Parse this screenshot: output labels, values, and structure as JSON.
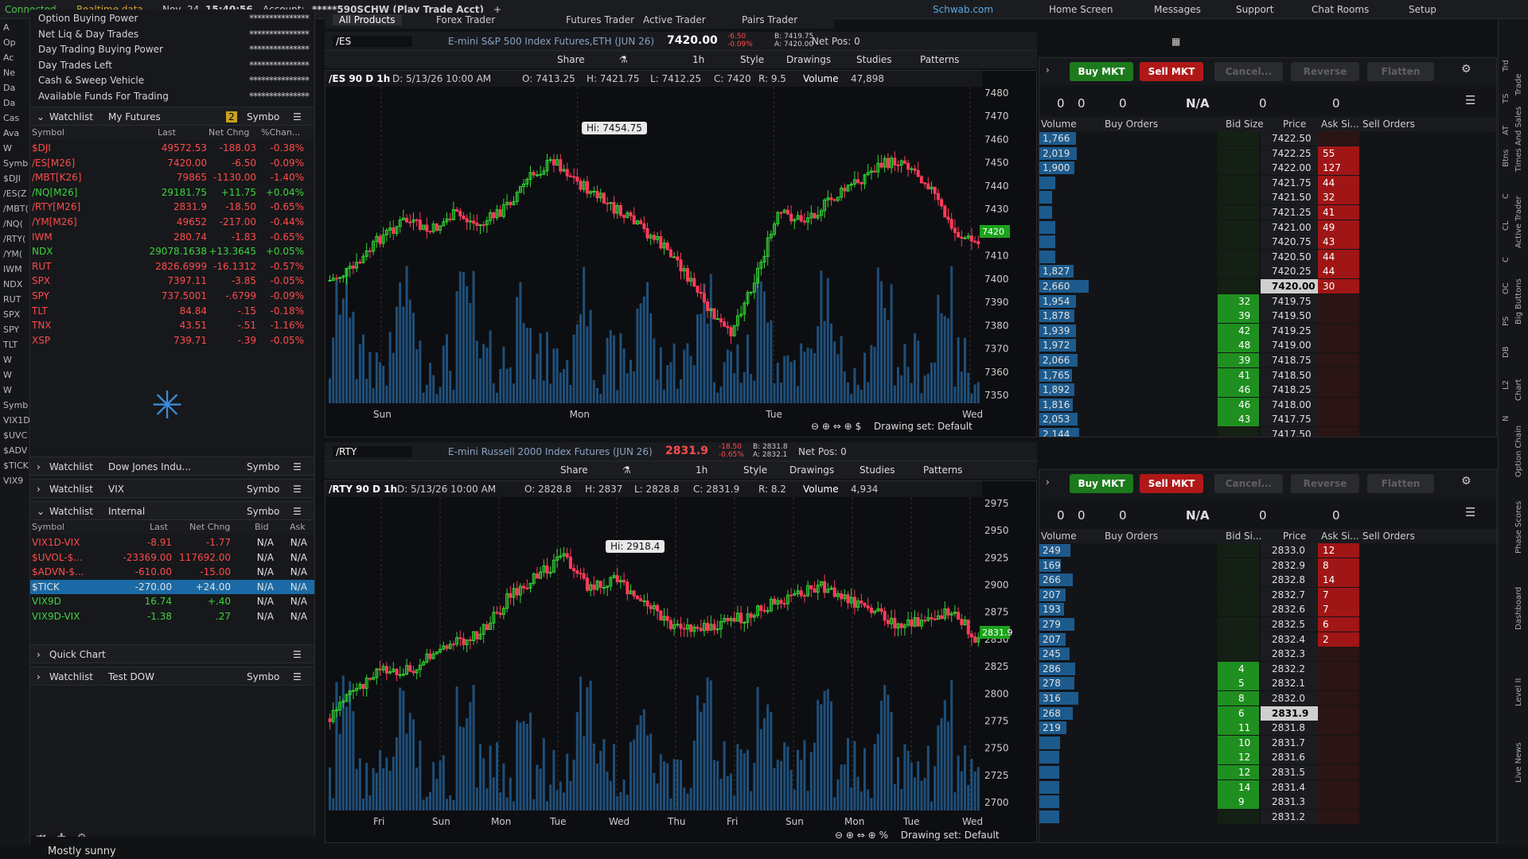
{
  "topbar": {
    "connected": "Connected",
    "realtime": "Realtime data",
    "date": "Nov, 24",
    "time": "15:40:56",
    "account_label": "Account:",
    "account": "*****590SCHW (Play Trade Acct)",
    "tabs": [
      "All Products",
      "Forex Trader",
      "Futures Trader",
      "Active Trader",
      "Pairs Trader"
    ],
    "links": [
      "Schwab.com",
      "Home Screen",
      "Messages",
      "Support",
      "Chat Rooms",
      "Setup"
    ]
  },
  "left_strip": {
    "items": [
      "A",
      "Op",
      "Ac",
      "Ne",
      "Da",
      "Da",
      "Cas",
      "Ava",
      "W",
      "Symb",
      "$DJI",
      "/ES(Z",
      "/MBT(",
      "/NQ(",
      "/RTY(",
      "/YM(",
      "IWM",
      "NDX",
      "RUT",
      "SPX",
      "SPY",
      "TLT",
      "W",
      "W",
      "W",
      "Symb",
      "VIX1D",
      "$UVC",
      "$ADV",
      "$TICK",
      "VIX9"
    ]
  },
  "balances": [
    {
      "label": "Option Buying Power",
      "value": "***************"
    },
    {
      "label": "Net Liq & Day Trades",
      "value": "***************"
    },
    {
      "label": "Day Trading Buying Power",
      "value": "***************"
    },
    {
      "label": "Day Trades Left",
      "value": "***************"
    },
    {
      "label": "Cash & Sweep Vehicle",
      "value": "***************"
    },
    {
      "label": "Available Funds For Trading",
      "value": "***************"
    }
  ],
  "watchlist1": {
    "title": "Watchlist",
    "name": "My Futures",
    "badge": "2",
    "symbol_field": "Symbo",
    "columns": [
      "Symbol",
      "Last",
      "Net Chng",
      "%Chan..."
    ],
    "rows": [
      {
        "sym": "$DJI",
        "last": "49572.53",
        "chg": "-188.03",
        "pct": "-0.38%",
        "dir": "dn"
      },
      {
        "sym": "/ES[M26]",
        "last": "7420.00",
        "chg": "-6.50",
        "pct": "-0.09%",
        "dir": "dn"
      },
      {
        "sym": "/MBT[K26]",
        "last": "79865",
        "chg": "-1130.00",
        "pct": "-1.40%",
        "dir": "dn"
      },
      {
        "sym": "/NQ[M26]",
        "last": "29181.75",
        "chg": "+11.75",
        "pct": "+0.04%",
        "dir": "up"
      },
      {
        "sym": "/RTY[M26]",
        "last": "2831.9",
        "chg": "-18.50",
        "pct": "-0.65%",
        "dir": "dn"
      },
      {
        "sym": "/YM[M26]",
        "last": "49652",
        "chg": "-217.00",
        "pct": "-0.44%",
        "dir": "dn"
      },
      {
        "sym": "IWM",
        "last": "280.74",
        "chg": "-1.83",
        "pct": "-0.65%",
        "dir": "dn"
      },
      {
        "sym": "NDX",
        "last": "29078.1638",
        "chg": "+13.3645",
        "pct": "+0.05%",
        "dir": "up"
      },
      {
        "sym": "RUT",
        "last": "2826.6999",
        "chg": "-16.1312",
        "pct": "-0.57%",
        "dir": "dn"
      },
      {
        "sym": "SPX",
        "last": "7397.11",
        "chg": "-3.85",
        "pct": "-0.05%",
        "dir": "dn"
      },
      {
        "sym": "SPY",
        "last": "737.5001",
        "chg": "-.6799",
        "pct": "-0.09%",
        "dir": "dn"
      },
      {
        "sym": "TLT",
        "last": "84.84",
        "chg": "-.15",
        "pct": "-0.18%",
        "dir": "dn"
      },
      {
        "sym": "TNX",
        "last": "43.51",
        "chg": "-.51",
        "pct": "-1.16%",
        "dir": "dn"
      },
      {
        "sym": "XSP",
        "last": "739.71",
        "chg": "-.39",
        "pct": "-0.05%",
        "dir": "dn"
      }
    ]
  },
  "watchlist_dow": {
    "title": "Watchlist",
    "name": "Dow Jones Indu...",
    "symbol_field": "Symbo"
  },
  "watchlist_vix": {
    "title": "Watchlist",
    "name": "VIX",
    "symbol_field": "Symbo"
  },
  "watchlist_internal": {
    "title": "Watchlist",
    "name": "Internal",
    "symbol_field": "Symbo",
    "columns": [
      "Symbol",
      "Last",
      "Net Chng",
      "Bid",
      "Ask"
    ],
    "rows": [
      {
        "sym": "VIX1D-VIX",
        "last": "-8.91",
        "chg": "-1.77",
        "bid": "N/A",
        "ask": "N/A",
        "dir": "dn"
      },
      {
        "sym": "$UVOL-$...",
        "last": "-23369.00",
        "chg": "117692.00",
        "bid": "N/A",
        "ask": "N/A",
        "dir": "dn"
      },
      {
        "sym": "$ADVN-$...",
        "last": "-610.00",
        "chg": "-15.00",
        "bid": "N/A",
        "ask": "N/A",
        "dir": "dn"
      },
      {
        "sym": "$TICK",
        "last": "-270.00",
        "chg": "+24.00",
        "bid": "N/A",
        "ask": "N/A",
        "dir": "sel"
      },
      {
        "sym": "VIX9D",
        "last": "16.74",
        "chg": "+.40",
        "bid": "N/A",
        "ask": "N/A",
        "dir": "up"
      },
      {
        "sym": "VIX9D-VIX",
        "last": "-1.38",
        "chg": ".27",
        "bid": "N/A",
        "ask": "N/A",
        "dir": "up"
      }
    ]
  },
  "quick_chart": {
    "label": "Quick Chart"
  },
  "watchlist_testdow": {
    "title": "Watchlist",
    "name": "Test DOW",
    "symbol_field": "Symbo"
  },
  "weather": "Mostly sunny",
  "chart1": {
    "symbol": "/ES",
    "desc": "E-mini S&P 500 Index Futures,ETH (JUN 26)",
    "price": "7420.00",
    "chg": "-6.50",
    "pct": "-0.09%",
    "bid": "B: 7419.75",
    "ask": "A: 7420.00",
    "netpos": "Net Pos: 0",
    "toolbar": [
      "Share",
      "1h",
      "Style",
      "Drawings",
      "Studies",
      "Patterns"
    ],
    "title": "/ES 90 D 1h",
    "ohlc": "D: 5/13/26 10:00 AM",
    "o": "O: 7413.25",
    "h": "H: 7421.75",
    "l": "L: 7412.25",
    "c": "C: 7420",
    "r": "R: 9.5",
    "vol_label": "Volume",
    "vol": "47,898",
    "hi": "Hi: 7454.75",
    "last_tag": "7420",
    "yticks": [
      "7480",
      "7470",
      "7460",
      "7450",
      "7440",
      "7430",
      "7420",
      "7410",
      "7400",
      "7390",
      "7380",
      "7370",
      "7360",
      "7350"
    ],
    "xticks": [
      "Sun",
      "Mon",
      "Tue",
      "Wed"
    ],
    "drawing_set": "Drawing set: Default"
  },
  "chart2": {
    "symbol": "/RTY",
    "desc": "E-mini Russell 2000 Index Futures (JUN 26)",
    "price": "2831.9",
    "chg": "-18.50",
    "pct": "-0.65%",
    "bid": "B: 2831.8",
    "ask": "A: 2832.1",
    "netpos": "Net Pos: 0",
    "toolbar": [
      "Share",
      "1h",
      "Style",
      "Drawings",
      "Studies",
      "Patterns"
    ],
    "title": "/RTY 90 D 1h",
    "ohlc": "D: 5/13/26 10:00 AM",
    "o": "O: 2828.8",
    "h": "H: 2837",
    "l": "L: 2828.8",
    "c": "C: 2831.9",
    "r": "R: 8.2",
    "vol_label": "Volume",
    "vol": "4,934",
    "hi": "Hi: 2918.4",
    "last_tag": "2831.9",
    "yticks": [
      "2975",
      "2950",
      "2925",
      "2900",
      "2875",
      "2850",
      "2825",
      "2800",
      "2775",
      "2750",
      "2725",
      "2700"
    ],
    "xticks": [
      "Fri",
      "Sun",
      "Mon",
      "Tue",
      "Wed",
      "Thu",
      "Fri",
      "Sun",
      "Mon",
      "Tue",
      "Wed"
    ],
    "drawing_set": "Drawing set: Default"
  },
  "at1": {
    "buttons": {
      "buy": "Buy MKT",
      "sell": "Sell MKT",
      "cancel": "Cancel...",
      "reverse": "Reverse",
      "flatten": "Flatten"
    },
    "stats": {
      "bs": "0",
      "bs2": "0",
      "pos_flat": "0",
      "avg": "N/A",
      "pl_open": "0",
      "pl_day": "0"
    },
    "headers": [
      "Volume",
      "Buy Orders",
      "Bid Size",
      "Price",
      "Ask Si...",
      "Sell Orders"
    ],
    "rows": [
      {
        "vol": "1,766",
        "bid": "",
        "price": "7422.50",
        "ask": "",
        "w": 70
      },
      {
        "vol": "2,019",
        "bid": "",
        "price": "7422.25",
        "ask": "55",
        "w": 72
      },
      {
        "vol": "1,900",
        "bid": "",
        "price": "7422.00",
        "ask": "127",
        "w": 68
      },
      {
        "vol": "",
        "bid": "",
        "price": "7421.75",
        "ask": "44",
        "w": 30
      },
      {
        "vol": "",
        "bid": "",
        "price": "7421.50",
        "ask": "32",
        "w": 25
      },
      {
        "vol": "",
        "bid": "",
        "price": "7421.25",
        "ask": "41",
        "w": 25
      },
      {
        "vol": "",
        "bid": "",
        "price": "7421.00",
        "ask": "49",
        "w": 30
      },
      {
        "vol": "",
        "bid": "",
        "price": "7420.75",
        "ask": "43",
        "w": 30
      },
      {
        "vol": "",
        "bid": "",
        "price": "7420.50",
        "ask": "44",
        "w": 30
      },
      {
        "vol": "1,827",
        "bid": "",
        "price": "7420.25",
        "ask": "44",
        "w": 66
      },
      {
        "vol": "2,660",
        "bid": "",
        "price": "7420.00",
        "ask": "30",
        "w": 95,
        "cur": true
      },
      {
        "vol": "1,954",
        "bid": "32",
        "price": "7419.75",
        "ask": "",
        "w": 70
      },
      {
        "vol": "1,878",
        "bid": "39",
        "price": "7419.50",
        "ask": "",
        "w": 67
      },
      {
        "vol": "1,939",
        "bid": "42",
        "price": "7419.25",
        "ask": "",
        "w": 70
      },
      {
        "vol": "1,972",
        "bid": "48",
        "price": "7419.00",
        "ask": "",
        "w": 71
      },
      {
        "vol": "2,066",
        "bid": "39",
        "price": "7418.75",
        "ask": "",
        "w": 74
      },
      {
        "vol": "1,765",
        "bid": "41",
        "price": "7418.50",
        "ask": "",
        "w": 63
      },
      {
        "vol": "1,892",
        "bid": "46",
        "price": "7418.25",
        "ask": "",
        "w": 68
      },
      {
        "vol": "1,816",
        "bid": "46",
        "price": "7418.00",
        "ask": "",
        "w": 65
      },
      {
        "vol": "2,053",
        "bid": "43",
        "price": "7417.75",
        "ask": "",
        "w": 74
      },
      {
        "vol": "2,144",
        "bid": "",
        "price": "7417.50",
        "ask": "",
        "w": 77
      }
    ]
  },
  "at2": {
    "buttons": {
      "buy": "Buy MKT",
      "sell": "Sell MKT",
      "cancel": "Cancel...",
      "reverse": "Reverse",
      "flatten": "Flatten"
    },
    "stats": {
      "bs": "0",
      "bs2": "0",
      "pos_flat": "0",
      "avg": "N/A",
      "pl_open": "0",
      "pl_day": "0"
    },
    "headers": [
      "Volume",
      "Buy Orders",
      "Bid Si...",
      "Price",
      "Ask Si...",
      "Sell Orders"
    ],
    "rows": [
      {
        "vol": "249",
        "bid": "",
        "price": "2833.0",
        "ask": "12",
        "w": 60
      },
      {
        "vol": "169",
        "bid": "",
        "price": "2832.9",
        "ask": "8",
        "w": 42
      },
      {
        "vol": "266",
        "bid": "",
        "price": "2832.8",
        "ask": "14",
        "w": 64
      },
      {
        "vol": "207",
        "bid": "",
        "price": "2832.7",
        "ask": "7",
        "w": 50
      },
      {
        "vol": "193",
        "bid": "",
        "price": "2832.6",
        "ask": "7",
        "w": 47
      },
      {
        "vol": "279",
        "bid": "",
        "price": "2832.5",
        "ask": "6",
        "w": 67
      },
      {
        "vol": "207",
        "bid": "",
        "price": "2832.4",
        "ask": "2",
        "w": 50
      },
      {
        "vol": "245",
        "bid": "",
        "price": "2832.3",
        "ask": "",
        "w": 59
      },
      {
        "vol": "286",
        "bid": "4",
        "price": "2832.2",
        "ask": "",
        "w": 69
      },
      {
        "vol": "278",
        "bid": "5",
        "price": "2832.1",
        "ask": "",
        "w": 67
      },
      {
        "vol": "316",
        "bid": "8",
        "price": "2832.0",
        "ask": "",
        "w": 76
      },
      {
        "vol": "268",
        "bid": "6",
        "price": "2831.9",
        "ask": "",
        "w": 65,
        "cur": true
      },
      {
        "vol": "219",
        "bid": "11",
        "price": "2831.8",
        "ask": "",
        "w": 53
      },
      {
        "vol": "",
        "bid": "10",
        "price": "2831.7",
        "ask": "",
        "w": 40
      },
      {
        "vol": "",
        "bid": "12",
        "price": "2831.6",
        "ask": "",
        "w": 38
      },
      {
        "vol": "",
        "bid": "12",
        "price": "2831.5",
        "ask": "",
        "w": 38
      },
      {
        "vol": "",
        "bid": "14",
        "price": "2831.4",
        "ask": "",
        "w": 38
      },
      {
        "vol": "",
        "bid": "9",
        "price": "2831.3",
        "ask": "",
        "w": 38
      },
      {
        "vol": "",
        "bid": "",
        "price": "2831.2",
        "ask": "",
        "w": 38
      }
    ]
  },
  "right_nav": [
    "Trd",
    "TS",
    "AT",
    "Btns",
    "C",
    "CL",
    "C",
    "OC",
    "PS",
    "DB",
    "L2",
    "N"
  ],
  "right_nav2": [
    "Trade",
    "Times And Sales",
    "Active Trader",
    "Big Buttons",
    "Chart",
    "Option Chain",
    "Phase Scores",
    "Dashboard",
    "Level II",
    "Live News"
  ],
  "colors": {
    "up": "#3fd23f",
    "down": "#ff4b4b",
    "accent": "#1b6aa5",
    "bid_green": "#1f8f1f",
    "ask_red": "#a01616"
  }
}
